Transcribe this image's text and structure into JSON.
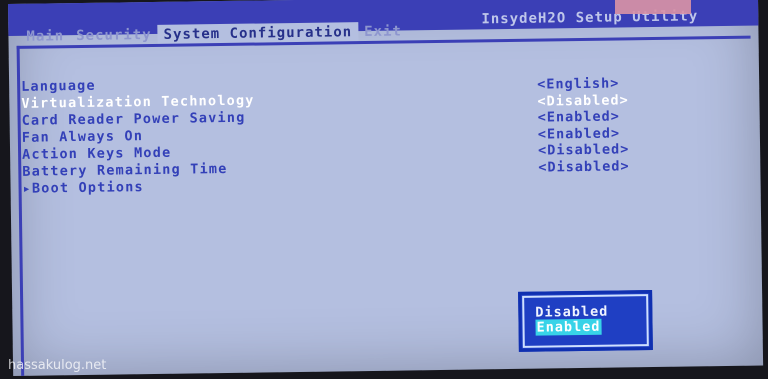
{
  "header": {
    "utility_title": "InsydeH2O Setup Utility"
  },
  "tabs": [
    {
      "label": "Main"
    },
    {
      "label": "Security"
    },
    {
      "label": "System Configuration"
    },
    {
      "label": "Exit"
    }
  ],
  "menu": [
    {
      "label": "Language",
      "value": "<English>"
    },
    {
      "label": "Virtualization Technology",
      "value": "<Disabled>"
    },
    {
      "label": "Card Reader Power Saving",
      "value": "<Enabled>"
    },
    {
      "label": "Fan Always On",
      "value": "<Enabled>"
    },
    {
      "label": "Action Keys Mode",
      "value": "<Disabled>"
    },
    {
      "label": "Battery Remaining Time",
      "value": "<Disabled>"
    },
    {
      "label": "▸Boot Options"
    }
  ],
  "popup": {
    "options": [
      "Disabled",
      "Enabled"
    ]
  },
  "watermark": "hassakulog.net",
  "colors": {
    "background": "#b4bfe0",
    "header": "#3b3fb6",
    "text": "#3340b8",
    "selected_text": "#ffffff",
    "popup_bg": "#1f3fc3",
    "popup_highlight": "#38d3e8"
  }
}
